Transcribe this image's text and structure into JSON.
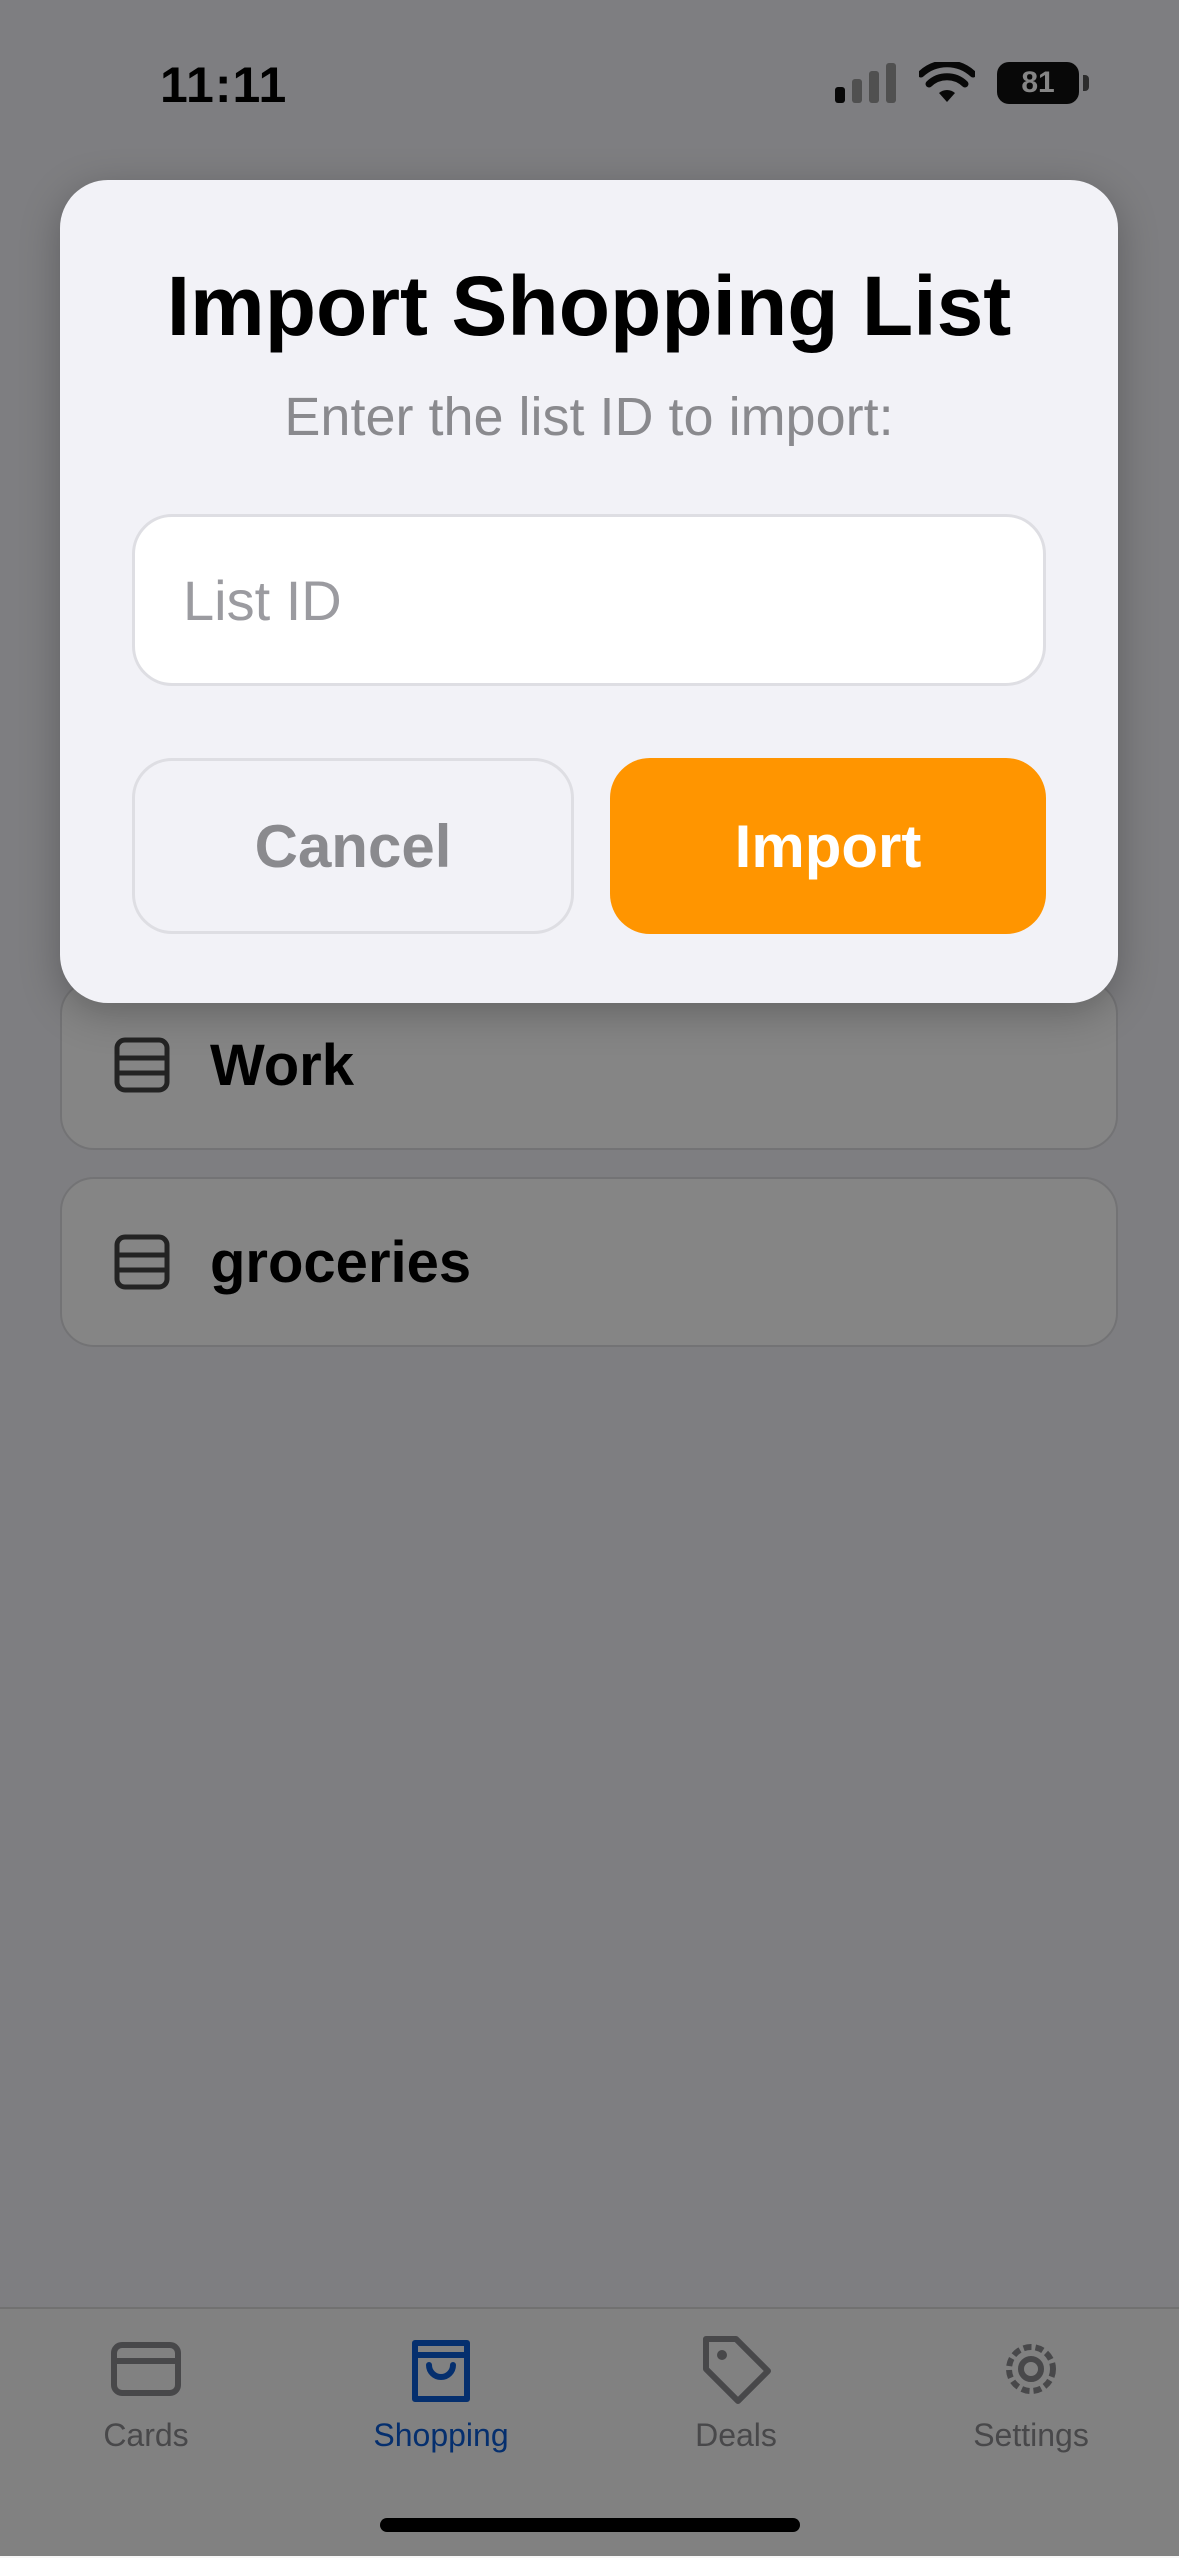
{
  "status_bar": {
    "time": "11:11",
    "battery": "81"
  },
  "lists": [
    {
      "label": "Work"
    },
    {
      "label": "groceries"
    }
  ],
  "dialog": {
    "title": "Import Shopping List",
    "subtitle": "Enter the list ID to import:",
    "input_placeholder": "List ID",
    "input_value": "",
    "cancel_label": "Cancel",
    "import_label": "Import"
  },
  "tabs": [
    {
      "label": "Cards",
      "icon": "credit-card-icon",
      "active": false
    },
    {
      "label": "Shopping",
      "icon": "shopping-bag-icon",
      "active": true
    },
    {
      "label": "Deals",
      "icon": "tag-icon",
      "active": false
    },
    {
      "label": "Settings",
      "icon": "gear-icon",
      "active": false
    }
  ],
  "colors": {
    "accent": "#ff9500",
    "tab_active": "#0a5bd3",
    "tab_inactive": "#8a8a8e"
  }
}
